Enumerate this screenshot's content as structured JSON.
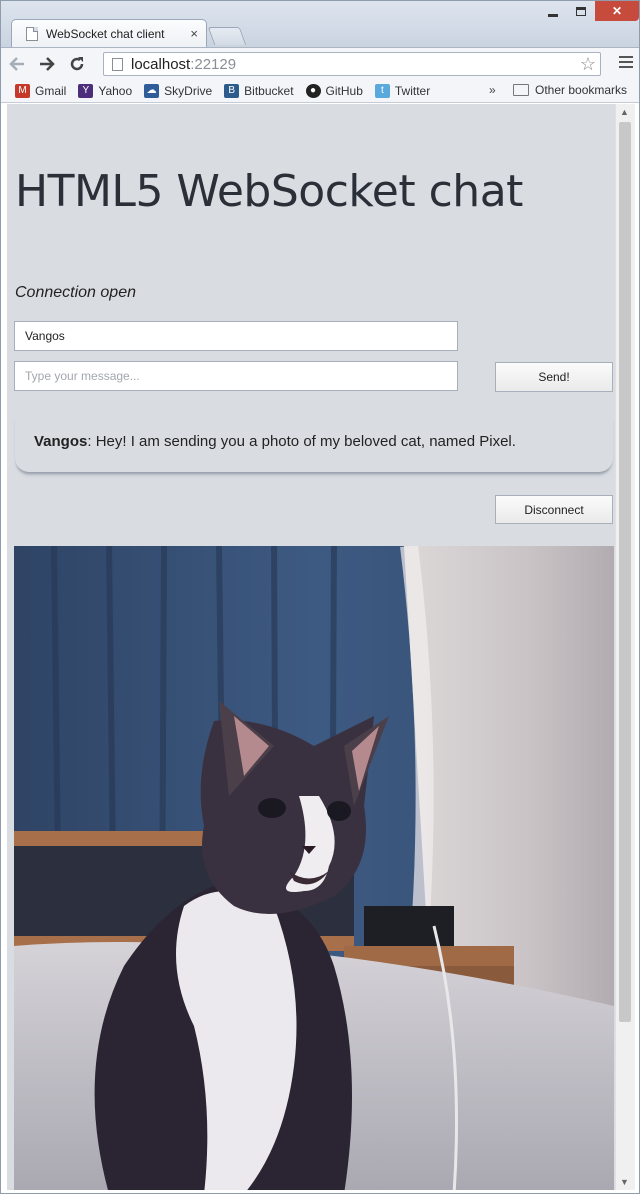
{
  "browser": {
    "tab_title": "WebSocket chat client",
    "tab_close": "×",
    "url_host": "localhost",
    "url_port": ":22129",
    "bookmarks": [
      {
        "label": "Gmail",
        "icon": "gmail-icon",
        "color": "#c5382a"
      },
      {
        "label": "Yahoo",
        "icon": "yahoo-icon",
        "color": "#4d2e7a"
      },
      {
        "label": "SkyDrive",
        "icon": "skydrive-icon",
        "color": "#2e5d9a"
      },
      {
        "label": "Bitbucket",
        "icon": "bitbucket-icon",
        "color": "#2d5b8b"
      },
      {
        "label": "GitHub",
        "icon": "github-icon",
        "color": "#222222"
      },
      {
        "label": "Twitter",
        "icon": "twitter-icon",
        "color": "#5aa9dd"
      }
    ],
    "bookmarks_more": "»",
    "other_bookmarks": "Other bookmarks"
  },
  "page": {
    "title": "HTML5 WebSocket chat",
    "status": "Connection open",
    "name_value": "Vangos",
    "message_placeholder": "Type your message...",
    "send_label": "Send!",
    "disconnect_label": "Disconnect",
    "messages": [
      {
        "author": "Vangos",
        "text": ": Hey! I am sending you a photo of my beloved cat, named Pixel."
      }
    ]
  },
  "colors": {
    "page_background": "#d9dde2",
    "close_button": "#c74b3c"
  }
}
